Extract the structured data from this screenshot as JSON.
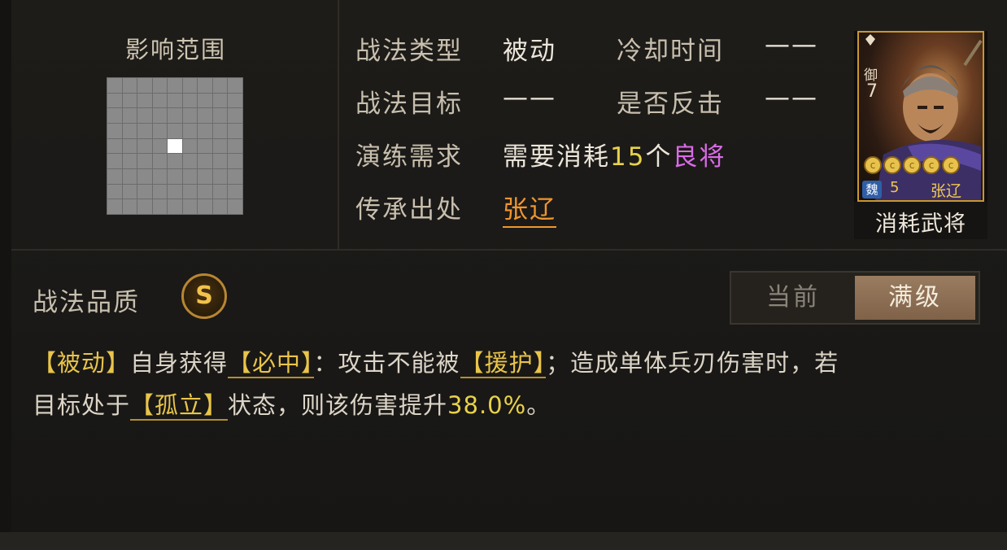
{
  "range_panel": {
    "title": "影响范围"
  },
  "info": {
    "type_label": "战法类型",
    "type_value": "被动",
    "cooldown_label": "冷却时间",
    "cooldown_value": "——",
    "target_label": "战法目标",
    "target_value": "——",
    "counter_label": "是否反击",
    "counter_value": "——",
    "drill_label": "演练需求",
    "drill_prefix": "需要消耗",
    "drill_count": "15",
    "drill_unit": "个",
    "drill_item": "良将",
    "source_label": "传承出处",
    "source_value": "张辽"
  },
  "card": {
    "rank_label": "御",
    "rank_num": "7",
    "stars": [
      "c",
      "c",
      "c",
      "c",
      "c"
    ],
    "faction": "魏",
    "cost": "5",
    "general_name": "张辽",
    "consume_label": "消耗武将"
  },
  "quality": {
    "label": "战法品质",
    "grade": "S"
  },
  "level_toggle": {
    "current": "当前",
    "max": "满级"
  },
  "description": {
    "kw_passive": "【被动】",
    "t1": "自身获得",
    "kw_sure_hit": "【必中】",
    "t2": "：攻击不能被",
    "kw_assist": "【援护】",
    "t3": "；造成单体兵刃伤害时，若",
    "t4": "目标处于",
    "kw_isolated": "【孤立】",
    "t5": "状态，则该伤害提升",
    "pct": "38.0%",
    "t6": "。"
  },
  "colors": {
    "keyword": "#e8c44a",
    "number": "#e8d24a",
    "quality_purple": "#d96be8",
    "link_orange": "#f0962e"
  }
}
